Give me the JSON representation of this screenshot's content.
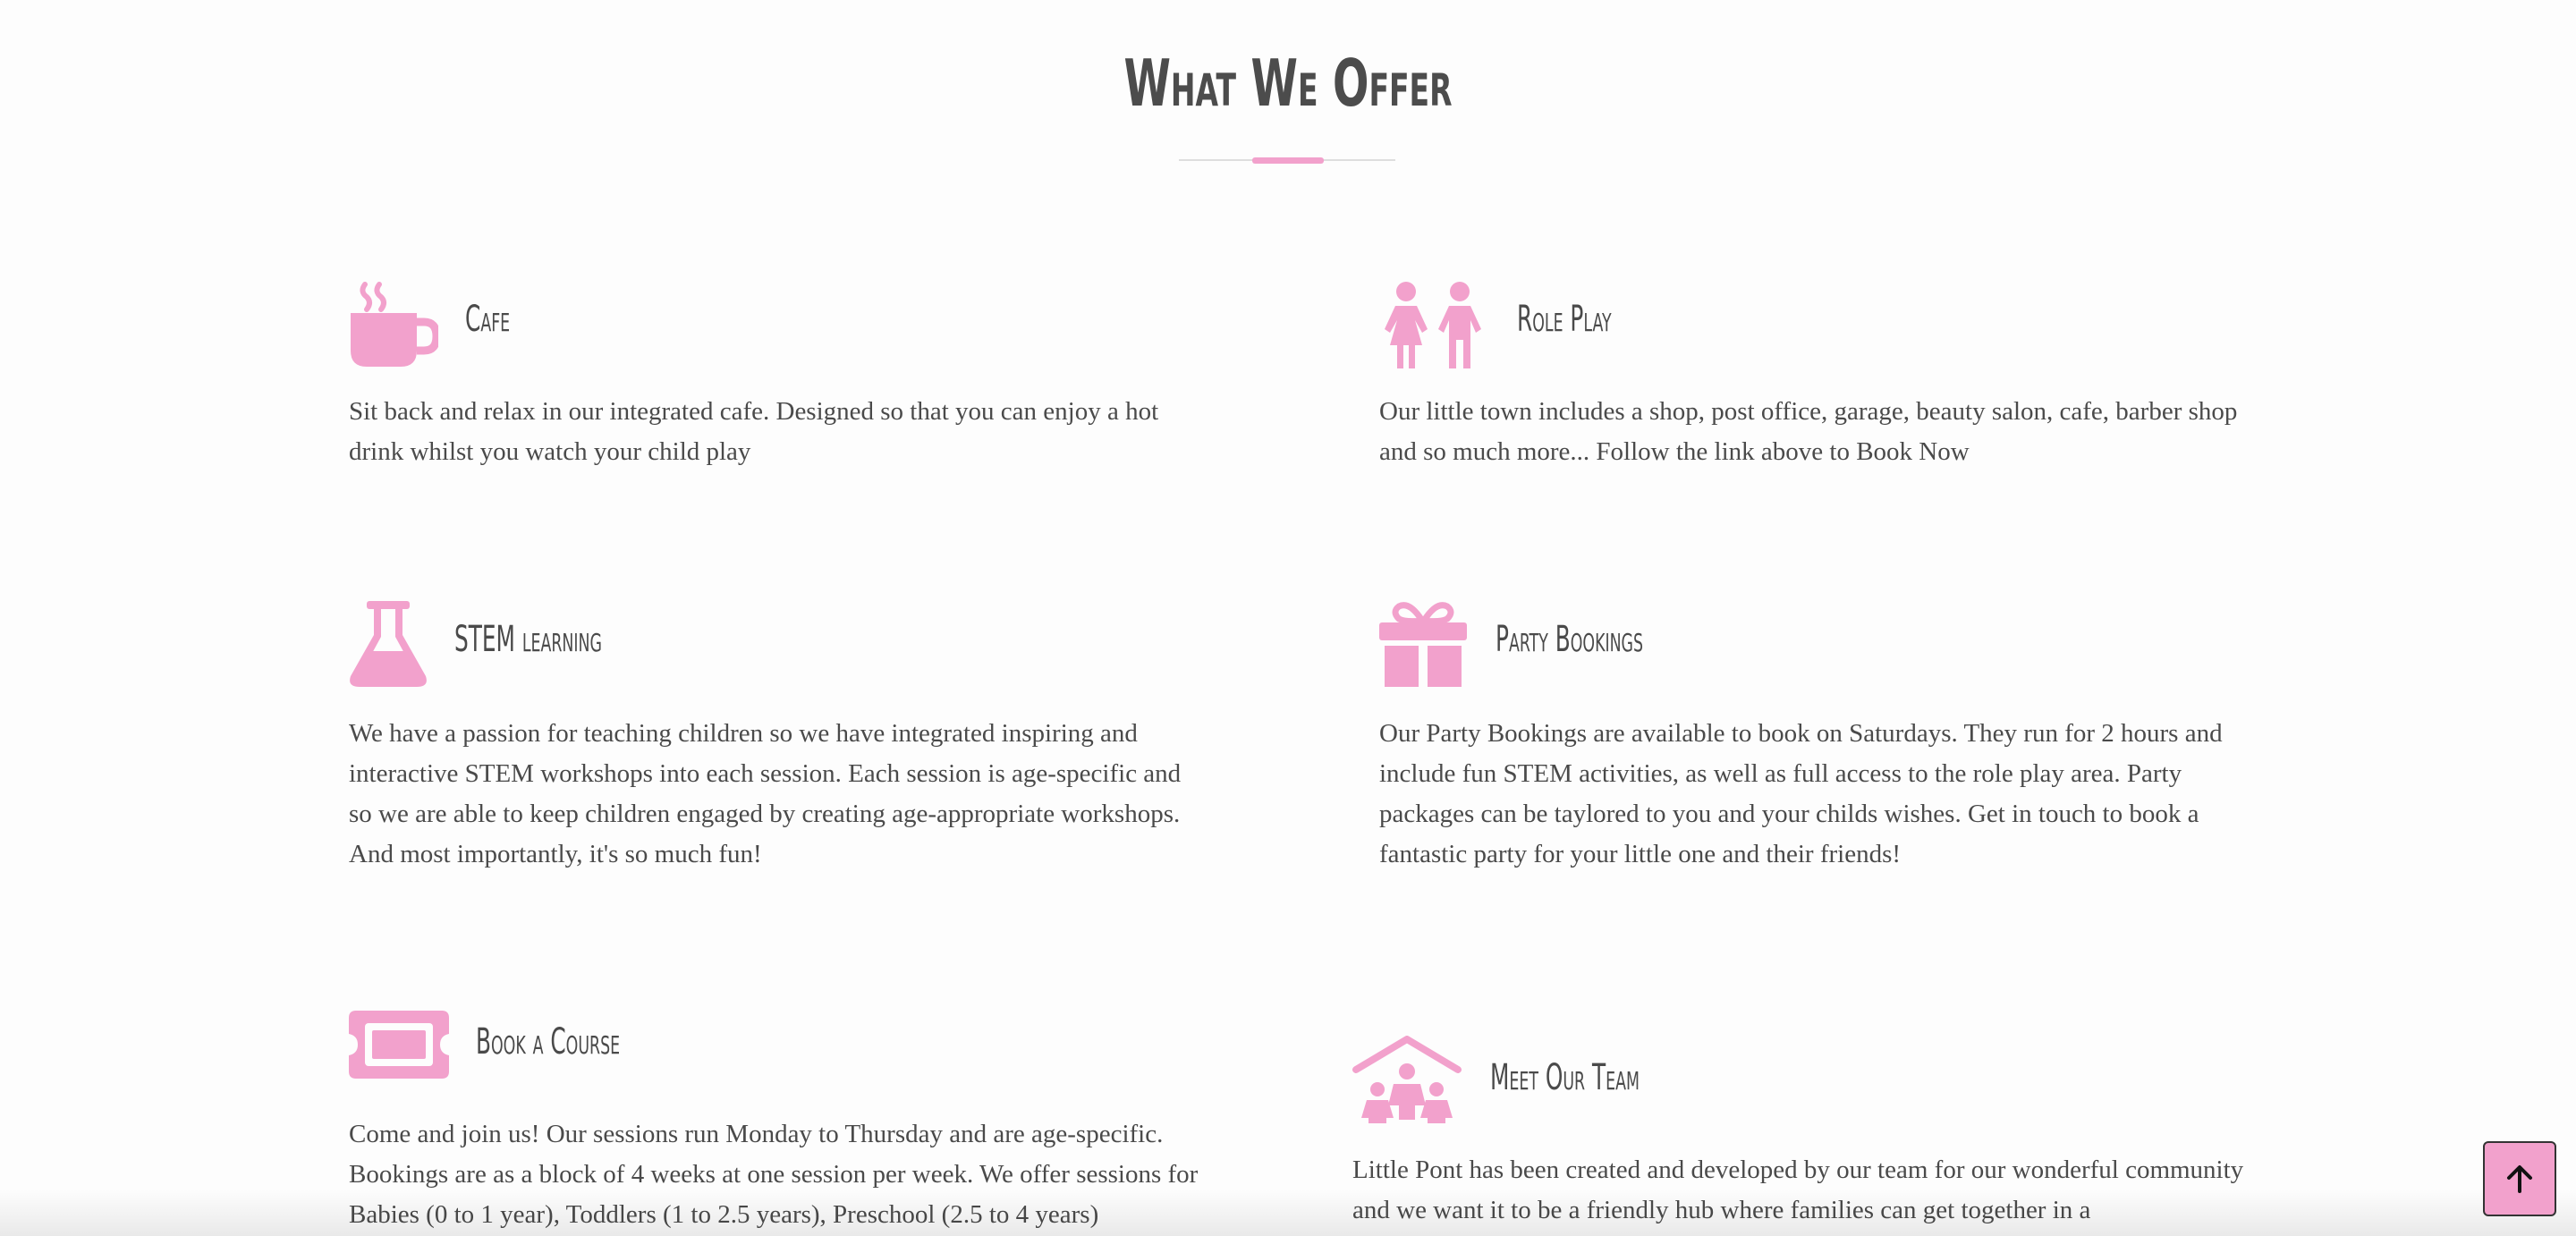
{
  "section": {
    "title": "What We Offer"
  },
  "colors": {
    "accent": "#f2a1cc",
    "text": "#4a4a4a",
    "divider": "#dedede"
  },
  "features": [
    {
      "icon": "coffee-cup-icon",
      "title": "Cafe",
      "text": "Sit back and relax in our integrated cafe. Designed so that you can enjoy a hot drink whilst you watch your child play"
    },
    {
      "icon": "children-icon",
      "title": "Role Play",
      "text": "Our little town includes a shop, post office, garage, beauty salon, cafe, barber shop and so much more... Follow the link above to Book Now"
    },
    {
      "icon": "flask-icon",
      "title": "STEM learning",
      "text": "We have a passion for teaching children so we have integrated inspiring and interactive STEM workshops into each session. Each session is age-specific and so we are able to keep children engaged by creating age-appropriate workshops. And most importantly, it's so much fun!"
    },
    {
      "icon": "gift-icon",
      "title": "Party Bookings",
      "text": "Our Party Bookings are available to book on Saturdays. They run for 2 hours and include fun STEM activities, as well as full access to the role play area. Party packages can be taylored to you and your childs wishes. Get in touch to book a fantastic party for your little one and their friends!"
    },
    {
      "icon": "ticket-icon",
      "title": "Book a Course",
      "text": "Come and join us! Our sessions run Monday to Thursday and are age-specific. Bookings are as a block of 4 weeks at one session per week. We offer sessions for Babies (0 to 1 year), Toddlers (1 to 2.5 years), Preschool (2.5 to 4 years)"
    },
    {
      "icon": "family-house-icon",
      "title": "Meet Our Team",
      "text": "Little Pont has been created and developed by our team for our wonderful community and we want it to be a friendly hub where families can get together in a"
    }
  ],
  "scroll_top": {
    "icon": "arrow-up-icon"
  }
}
